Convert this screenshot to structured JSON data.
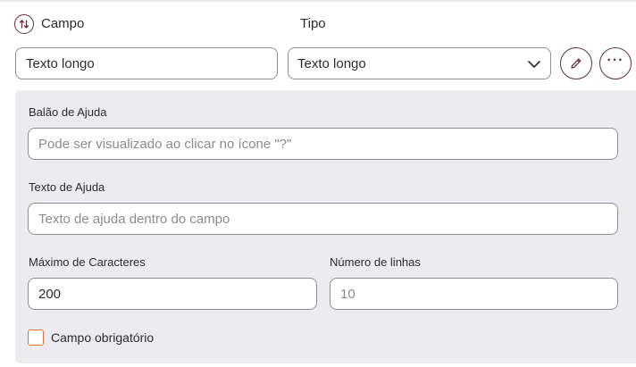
{
  "header": {
    "campo_label": "Campo",
    "tipo_label": "Tipo"
  },
  "campo": {
    "value": "Texto longo"
  },
  "tipo": {
    "selected": "Texto longo"
  },
  "icons": {
    "sort": "sort-arrows-icon",
    "edit": "pencil-icon",
    "more": "ellipsis-icon",
    "dropdown": "chevron-down-icon"
  },
  "more_button": {
    "glyph": "···"
  },
  "details": {
    "help_balloon": {
      "label": "Balão de Ajuda",
      "placeholder": "Pode ser visualizado ao clicar no ícone \"?\"",
      "value": ""
    },
    "help_text": {
      "label": "Texto de Ajuda",
      "placeholder": "Texto de ajuda dentro do campo",
      "value": ""
    },
    "max_chars": {
      "label": "Máximo de Caracteres",
      "value": "200"
    },
    "line_count": {
      "label": "Número de linhas",
      "placeholder": "10",
      "value": ""
    },
    "required": {
      "label": "Campo obrigatório",
      "checked": false
    }
  },
  "colors": {
    "accent": "#6b2d3b",
    "checkbox_border": "#d9733a",
    "panel_bg": "#ececf0",
    "input_border": "#8f8f95"
  }
}
